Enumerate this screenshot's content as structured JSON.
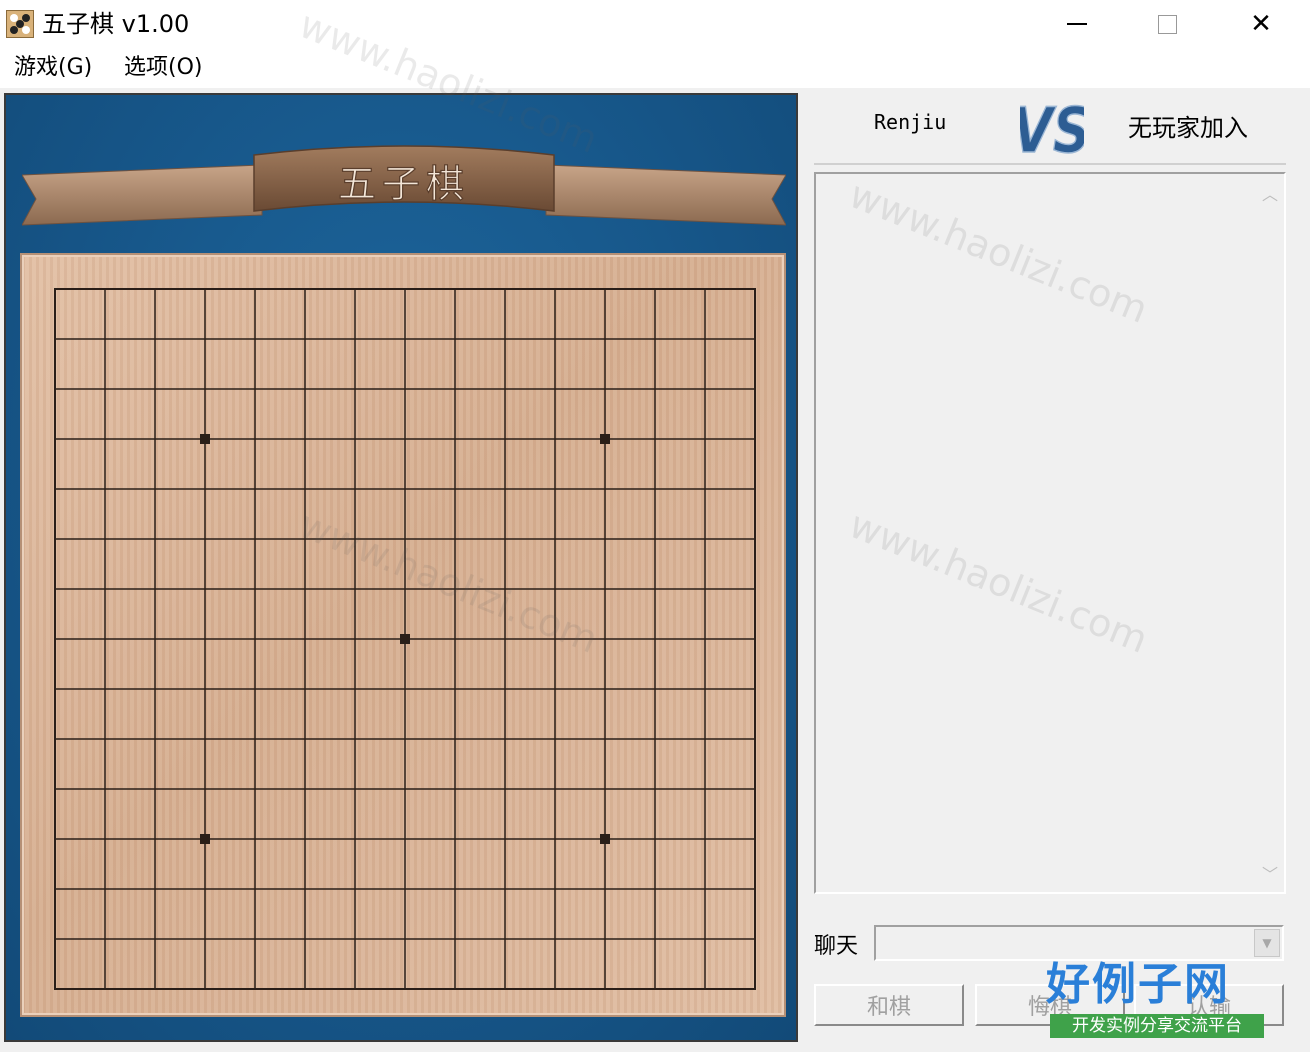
{
  "window": {
    "title": "五子棋 v1.00",
    "minimize_glyph": "—",
    "maximize_glyph": "☐",
    "close_glyph": "✕"
  },
  "menu": [
    {
      "label": "游戏(G)"
    },
    {
      "label": "选项(O)"
    }
  ],
  "board": {
    "banner_text": "五子棋",
    "grid_lines": 15,
    "star_points": [
      [
        3,
        3
      ],
      [
        3,
        11
      ],
      [
        7,
        7
      ],
      [
        11,
        3
      ],
      [
        11,
        11
      ]
    ],
    "line_color": "#2a1f18",
    "wood_color": "#dcb79b"
  },
  "players": {
    "player1": "Renjiu",
    "vs_text": "VS",
    "player2": "无玩家加入"
  },
  "chat": {
    "label": "聊天",
    "input_value": ""
  },
  "buttons": {
    "draw": "和棋",
    "undo": "悔棋",
    "resign": "认输"
  },
  "watermark": {
    "text": "www.haolizi.com",
    "logo_main": "好例子网",
    "logo_sub": "开发实例分享交流平台"
  },
  "icons": {
    "app": "gomoku-board-icon",
    "scroll_up": "chevron-up-icon",
    "scroll_down": "chevron-down-icon",
    "dropdown": "dropdown-arrow-icon"
  }
}
